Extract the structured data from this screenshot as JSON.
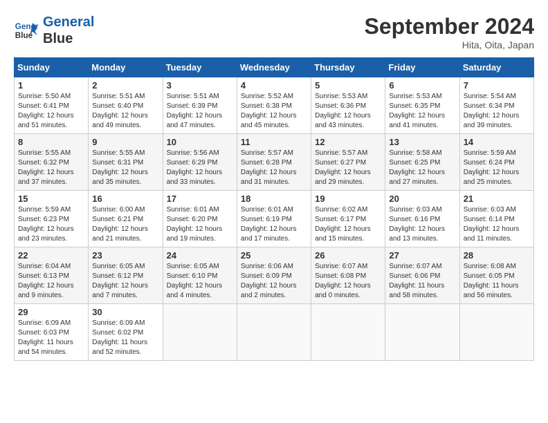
{
  "header": {
    "logo_line1": "General",
    "logo_line2": "Blue",
    "month": "September 2024",
    "location": "Hita, Oita, Japan"
  },
  "weekdays": [
    "Sunday",
    "Monday",
    "Tuesday",
    "Wednesday",
    "Thursday",
    "Friday",
    "Saturday"
  ],
  "weeks": [
    [
      {
        "day": "1",
        "info": "Sunrise: 5:50 AM\nSunset: 6:41 PM\nDaylight: 12 hours\nand 51 minutes."
      },
      {
        "day": "2",
        "info": "Sunrise: 5:51 AM\nSunset: 6:40 PM\nDaylight: 12 hours\nand 49 minutes."
      },
      {
        "day": "3",
        "info": "Sunrise: 5:51 AM\nSunset: 6:39 PM\nDaylight: 12 hours\nand 47 minutes."
      },
      {
        "day": "4",
        "info": "Sunrise: 5:52 AM\nSunset: 6:38 PM\nDaylight: 12 hours\nand 45 minutes."
      },
      {
        "day": "5",
        "info": "Sunrise: 5:53 AM\nSunset: 6:36 PM\nDaylight: 12 hours\nand 43 minutes."
      },
      {
        "day": "6",
        "info": "Sunrise: 5:53 AM\nSunset: 6:35 PM\nDaylight: 12 hours\nand 41 minutes."
      },
      {
        "day": "7",
        "info": "Sunrise: 5:54 AM\nSunset: 6:34 PM\nDaylight: 12 hours\nand 39 minutes."
      }
    ],
    [
      {
        "day": "8",
        "info": "Sunrise: 5:55 AM\nSunset: 6:32 PM\nDaylight: 12 hours\nand 37 minutes."
      },
      {
        "day": "9",
        "info": "Sunrise: 5:55 AM\nSunset: 6:31 PM\nDaylight: 12 hours\nand 35 minutes."
      },
      {
        "day": "10",
        "info": "Sunrise: 5:56 AM\nSunset: 6:29 PM\nDaylight: 12 hours\nand 33 minutes."
      },
      {
        "day": "11",
        "info": "Sunrise: 5:57 AM\nSunset: 6:28 PM\nDaylight: 12 hours\nand 31 minutes."
      },
      {
        "day": "12",
        "info": "Sunrise: 5:57 AM\nSunset: 6:27 PM\nDaylight: 12 hours\nand 29 minutes."
      },
      {
        "day": "13",
        "info": "Sunrise: 5:58 AM\nSunset: 6:25 PM\nDaylight: 12 hours\nand 27 minutes."
      },
      {
        "day": "14",
        "info": "Sunrise: 5:59 AM\nSunset: 6:24 PM\nDaylight: 12 hours\nand 25 minutes."
      }
    ],
    [
      {
        "day": "15",
        "info": "Sunrise: 5:59 AM\nSunset: 6:23 PM\nDaylight: 12 hours\nand 23 minutes."
      },
      {
        "day": "16",
        "info": "Sunrise: 6:00 AM\nSunset: 6:21 PM\nDaylight: 12 hours\nand 21 minutes."
      },
      {
        "day": "17",
        "info": "Sunrise: 6:01 AM\nSunset: 6:20 PM\nDaylight: 12 hours\nand 19 minutes."
      },
      {
        "day": "18",
        "info": "Sunrise: 6:01 AM\nSunset: 6:19 PM\nDaylight: 12 hours\nand 17 minutes."
      },
      {
        "day": "19",
        "info": "Sunrise: 6:02 AM\nSunset: 6:17 PM\nDaylight: 12 hours\nand 15 minutes."
      },
      {
        "day": "20",
        "info": "Sunrise: 6:03 AM\nSunset: 6:16 PM\nDaylight: 12 hours\nand 13 minutes."
      },
      {
        "day": "21",
        "info": "Sunrise: 6:03 AM\nSunset: 6:14 PM\nDaylight: 12 hours\nand 11 minutes."
      }
    ],
    [
      {
        "day": "22",
        "info": "Sunrise: 6:04 AM\nSunset: 6:13 PM\nDaylight: 12 hours\nand 9 minutes."
      },
      {
        "day": "23",
        "info": "Sunrise: 6:05 AM\nSunset: 6:12 PM\nDaylight: 12 hours\nand 7 minutes."
      },
      {
        "day": "24",
        "info": "Sunrise: 6:05 AM\nSunset: 6:10 PM\nDaylight: 12 hours\nand 4 minutes."
      },
      {
        "day": "25",
        "info": "Sunrise: 6:06 AM\nSunset: 6:09 PM\nDaylight: 12 hours\nand 2 minutes."
      },
      {
        "day": "26",
        "info": "Sunrise: 6:07 AM\nSunset: 6:08 PM\nDaylight: 12 hours\nand 0 minutes."
      },
      {
        "day": "27",
        "info": "Sunrise: 6:07 AM\nSunset: 6:06 PM\nDaylight: 11 hours\nand 58 minutes."
      },
      {
        "day": "28",
        "info": "Sunrise: 6:08 AM\nSunset: 6:05 PM\nDaylight: 11 hours\nand 56 minutes."
      }
    ],
    [
      {
        "day": "29",
        "info": "Sunrise: 6:09 AM\nSunset: 6:03 PM\nDaylight: 11 hours\nand 54 minutes."
      },
      {
        "day": "30",
        "info": "Sunrise: 6:09 AM\nSunset: 6:02 PM\nDaylight: 11 hours\nand 52 minutes."
      },
      {
        "day": "",
        "info": ""
      },
      {
        "day": "",
        "info": ""
      },
      {
        "day": "",
        "info": ""
      },
      {
        "day": "",
        "info": ""
      },
      {
        "day": "",
        "info": ""
      }
    ]
  ]
}
